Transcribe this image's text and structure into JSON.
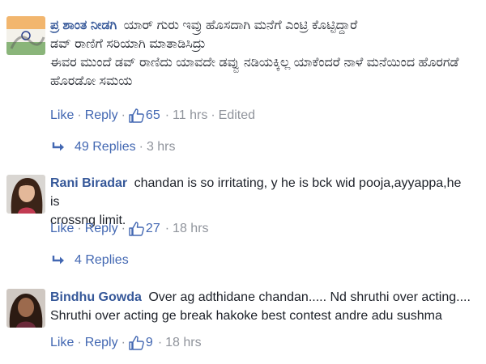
{
  "actions": {
    "like_label": "Like",
    "reply_label": "Reply",
    "separator": "·"
  },
  "comments": [
    {
      "author": "ಪ್ರ ಶಾಂತ ನೀಡಗಿ",
      "text_line1": "ಯಾರ್ ಗುರು ಇವ್ರು ಹೊಸದಾಗಿ ಮನೆಗೆ ಎಂಟ್ರಿ ಕೊಟ್ಟಿದ್ದಾರೆ",
      "text_line2": "ಡವ್ ರಾಣಿಗೆ ಸರಿಯಾಗಿ ಮಾತಾಡಿಸಿದ್ರು",
      "text_line3": "ಈವರ ಮುಂದೆ ಡವ್ ರಾಣಿದು ಯಾವದೇ ಡವ್ವು ನಡಿಯಕ್ಕಿಲ್ಲ ಯಾಕೆಂದರೆ ನಾಳೆ ಮನೆಯಿಂದ ಹೊರಗಡೆ",
      "text_line4": "ಹೊರಡೋ ಸಮಯ",
      "likes": "65",
      "time": "11 hrs",
      "edited": "Edited",
      "replies_label": "49 Replies",
      "replies_time": "3 hrs"
    },
    {
      "author": "Rani Biradar",
      "text_line1": "chandan is so irritating, y he is bck wid pooja,ayyappa,he is",
      "text_line2": "crossng limit.",
      "likes": "27",
      "time": "18 hrs",
      "replies_label": "4 Replies"
    },
    {
      "author": "Bindhu Gowda",
      "text_line1": "Over ag adthidane chandan..... Nd shruthi over acting....",
      "text_line2": "Shruthi over acting ge break hakoke best contest andre adu sushma",
      "likes": "9",
      "time": "18 hrs"
    }
  ],
  "colors": {
    "author": "#365899",
    "link": "#4267b2",
    "muted": "#90949c",
    "text": "#1d2129"
  },
  "icons": {
    "like": "thumbs-up-icon",
    "reply_arrow": "reply-arrow-icon"
  }
}
